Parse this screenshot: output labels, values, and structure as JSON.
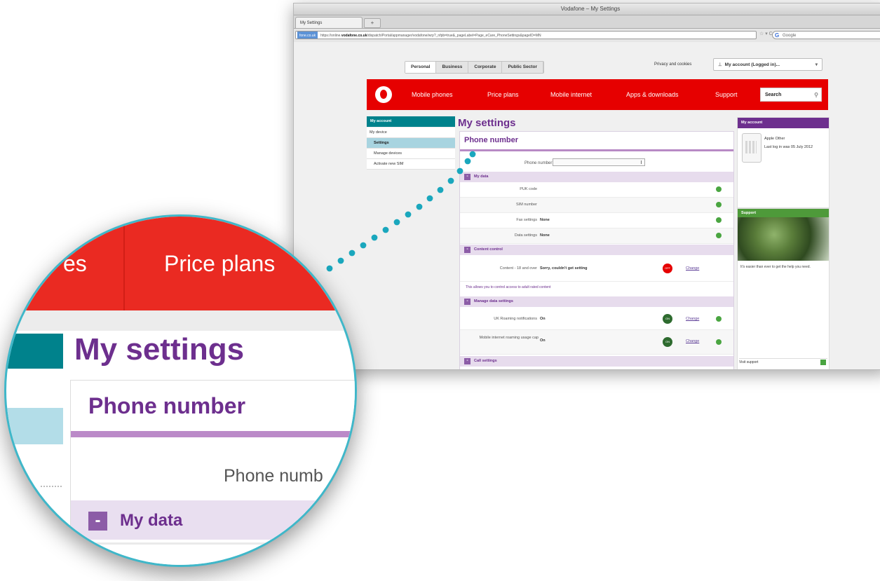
{
  "browser": {
    "window_title": "Vodafone – My Settings",
    "tab_label": "My Settings",
    "new_tab": "+",
    "url_site": "fone.co.uk",
    "url_prefix": "https://online.",
    "url_domain": "vodafone.co.uk",
    "url_path": "/dispatch/Portal/appmanager/vodafone/wrp?_nfpb=true&_pageLabel=Page_eCare_PhoneSettings&pageID=MN",
    "nav_buttons": "☆ ▾ C",
    "google_search": "Google"
  },
  "header": {
    "segments": [
      "Personal",
      "Business",
      "Corporate",
      "Public Sector"
    ],
    "privacy": "Privacy and cookies",
    "my_account": "My account (Logged in)..."
  },
  "topnav": {
    "items": [
      "Mobile phones",
      "Price plans",
      "Mobile internet",
      "Apps & downloads",
      "Support"
    ],
    "search_label": "Search"
  },
  "sidebar": {
    "heading": "My account",
    "items": [
      "My device",
      "Settings",
      "Manage devices",
      "Activate new SIM"
    ]
  },
  "main": {
    "title": "My settings",
    "phone_number_heading": "Phone number",
    "phone_number_label": "Phone number:",
    "sections": {
      "my_data": {
        "title": "My data",
        "rows": [
          {
            "label": "PUK code",
            "value": ""
          },
          {
            "label": "SIM number",
            "value": ""
          },
          {
            "label": "Fax settings",
            "value": "None"
          },
          {
            "label": "Data settings",
            "value": "None"
          }
        ]
      },
      "content_control": {
        "title": "Content control",
        "row_label": "Content - 18 and over",
        "row_value": "Sorry, couldn't get setting",
        "status": "OFF",
        "change": "Change",
        "note": "This allows you to control access to adult rated content"
      },
      "data_settings": {
        "title": "Manage data settings",
        "rows": [
          {
            "label": "UK Roaming notifications",
            "value": "On",
            "status": "ON",
            "change": "Change"
          },
          {
            "label": "Mobile internet roaming usage cap",
            "value": "On",
            "status": "ON",
            "change": "Change"
          }
        ]
      },
      "call_settings": {
        "title": "Call settings"
      }
    }
  },
  "right": {
    "account_heading": "My account",
    "account_name": "Apple Other",
    "last_login": "Last log in was 05 July 2012",
    "support_heading": "Support",
    "support_text": "It's easier than ever to get the help you need.",
    "visit_support": "Visit support"
  },
  "magnifier": {
    "nav_fragment": "es",
    "nav_price_plans": "Price plans",
    "title": "My settings",
    "phone_heading": "Phone number",
    "phone_label_fragment": "Phone numb",
    "section_minus": "-",
    "section_title": "My data"
  },
  "colors": {
    "vodafone_red": "#e60000",
    "purple": "#6d2f8e",
    "teal": "#00828c",
    "magnifier_ring": "#3fb7c9"
  }
}
